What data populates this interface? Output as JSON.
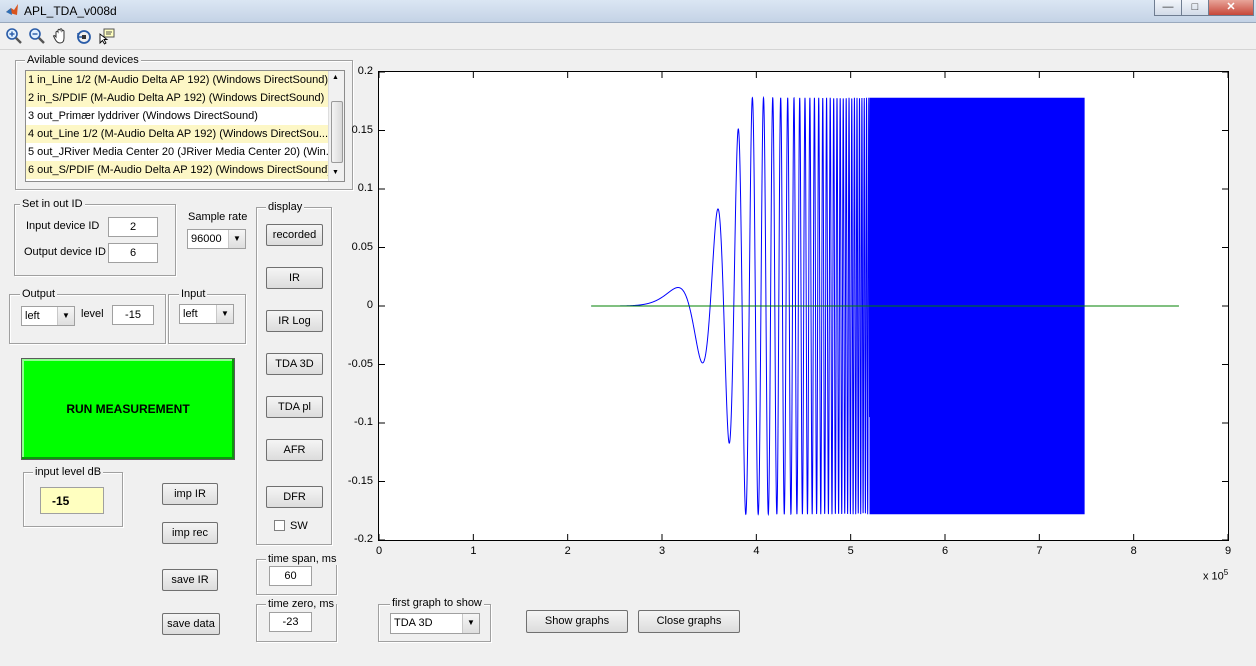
{
  "window": {
    "title": "APL_TDA_v008d",
    "minimize": "—",
    "maximize": "□",
    "close": "✕"
  },
  "toolbar": {
    "tools": [
      "zoom-in-icon",
      "zoom-out-icon",
      "pan-hand-icon",
      "rotate-3d-icon",
      "data-cursor-icon"
    ]
  },
  "devices": {
    "title": "Avilable sound devices",
    "items": [
      {
        "label": "1 in_Line 1/2 (M-Audio Delta AP 192) (Windows DirectSound)",
        "selected": true
      },
      {
        "label": "2 in_S/PDIF (M-Audio Delta AP 192) (Windows DirectSound)",
        "selected": true
      },
      {
        "label": "3 out_Primær lyddriver (Windows DirectSound)",
        "selected": false
      },
      {
        "label": "4 out_Line 1/2 (M-Audio Delta AP 192) (Windows DirectSou...",
        "selected": true
      },
      {
        "label": "5 out_JRiver Media Center 20 (JRiver Media Center 20) (Win...",
        "selected": false
      },
      {
        "label": "6 out_S/PDIF (M-Audio Delta AP 192) (Windows DirectSound)",
        "selected": true
      }
    ]
  },
  "io_ids": {
    "title": "Set in out ID",
    "input_label": "Input device ID",
    "input_value": "2",
    "output_label": "Output device ID",
    "output_value": "6"
  },
  "sample_rate": {
    "label": "Sample rate",
    "value": "96000"
  },
  "output": {
    "title": "Output",
    "channel": "left",
    "level_label": "level",
    "level_value": "-15"
  },
  "input": {
    "title": "Input",
    "channel": "left"
  },
  "run_button": {
    "label": "RUN MEASUREMENT",
    "color": "#00ff00"
  },
  "input_level": {
    "title": "input level dB",
    "value": "-15",
    "bg": "#ffffc0"
  },
  "actions": {
    "imp_ir": "imp IR",
    "imp_rec": "imp rec",
    "save_ir": "save IR",
    "save_data": "save data"
  },
  "display": {
    "title": "display",
    "buttons": [
      "recorded",
      "IR",
      "IR Log",
      "TDA 3D",
      "TDA pl",
      "AFR",
      "DFR"
    ],
    "sw_label": "SW",
    "sw_checked": false
  },
  "time_span": {
    "label": "time span, ms",
    "value": "60"
  },
  "time_zero": {
    "label": "time zero, ms",
    "value": "-23"
  },
  "first_graph": {
    "label": "first graph to show",
    "value": "TDA 3D"
  },
  "show_graphs": "Show graphs",
  "close_graphs": "Close graphs",
  "chart_data": {
    "type": "line",
    "title": "",
    "xlabel": "",
    "ylabel": "",
    "x_exponent_label": "x 10",
    "x_exponent": "5",
    "xlim": [
      0,
      9
    ],
    "ylim": [
      -0.2,
      0.2
    ],
    "xticks": [
      "0",
      "1",
      "2",
      "3",
      "4",
      "5",
      "6",
      "7",
      "8",
      "9"
    ],
    "yticks": [
      "0.2",
      "0.15",
      "0.1",
      "0.05",
      "0",
      "-0.05",
      "-0.1",
      "-0.15",
      "-0.2"
    ],
    "grid": false,
    "series": [
      {
        "kind": "sweep",
        "color": "#0000ff",
        "x_start": 2.25,
        "x_end": 7.48,
        "amplitude": 0.178,
        "fill_from": 5.2
      },
      {
        "kind": "hline",
        "color": "#008000",
        "x_start": 2.25,
        "x_end": 8.48,
        "y": 0
      }
    ]
  }
}
